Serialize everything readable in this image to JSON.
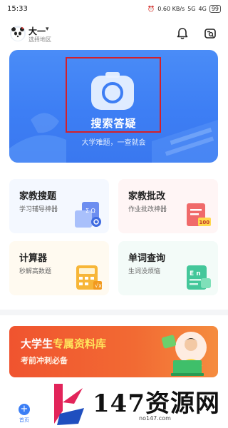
{
  "status_bar": {
    "time": "15:33",
    "network_speed": "0.60 KB/s",
    "signal_1": "5G",
    "signal_2": "4G",
    "battery": "99"
  },
  "header": {
    "location_name": "大一",
    "location_sub": "选择地区"
  },
  "hero": {
    "title": "搜索答疑",
    "subtitle": "大学难题，一查就会"
  },
  "cards": [
    {
      "title": "家教搜题",
      "subtitle": "学习辅导神器",
      "bg": "#f4f8ff",
      "icon": "books-icon"
    },
    {
      "title": "家教批改",
      "subtitle": "作业批改神器",
      "bg": "#fff5f5",
      "icon": "graded-paper-icon",
      "badge": "100"
    },
    {
      "title": "计算器",
      "subtitle": "秒解高数题",
      "bg": "#fffaf0",
      "icon": "calculator-icon"
    },
    {
      "title": "单词查询",
      "subtitle": "生词没烦恼",
      "bg": "#f3fbf8",
      "icon": "vocabulary-book-icon"
    }
  ],
  "banner": {
    "title_part1": "大学生",
    "title_part2": "专属资料库",
    "subtitle": "考前冲刺必备"
  },
  "tabbar": {
    "home_label": "首页"
  },
  "watermark": {
    "text": "147资源网",
    "url": "no147.com"
  },
  "colors": {
    "primary": "#3b7ef5",
    "banner": "#f0542f",
    "highlight_box": "#d3202a"
  }
}
